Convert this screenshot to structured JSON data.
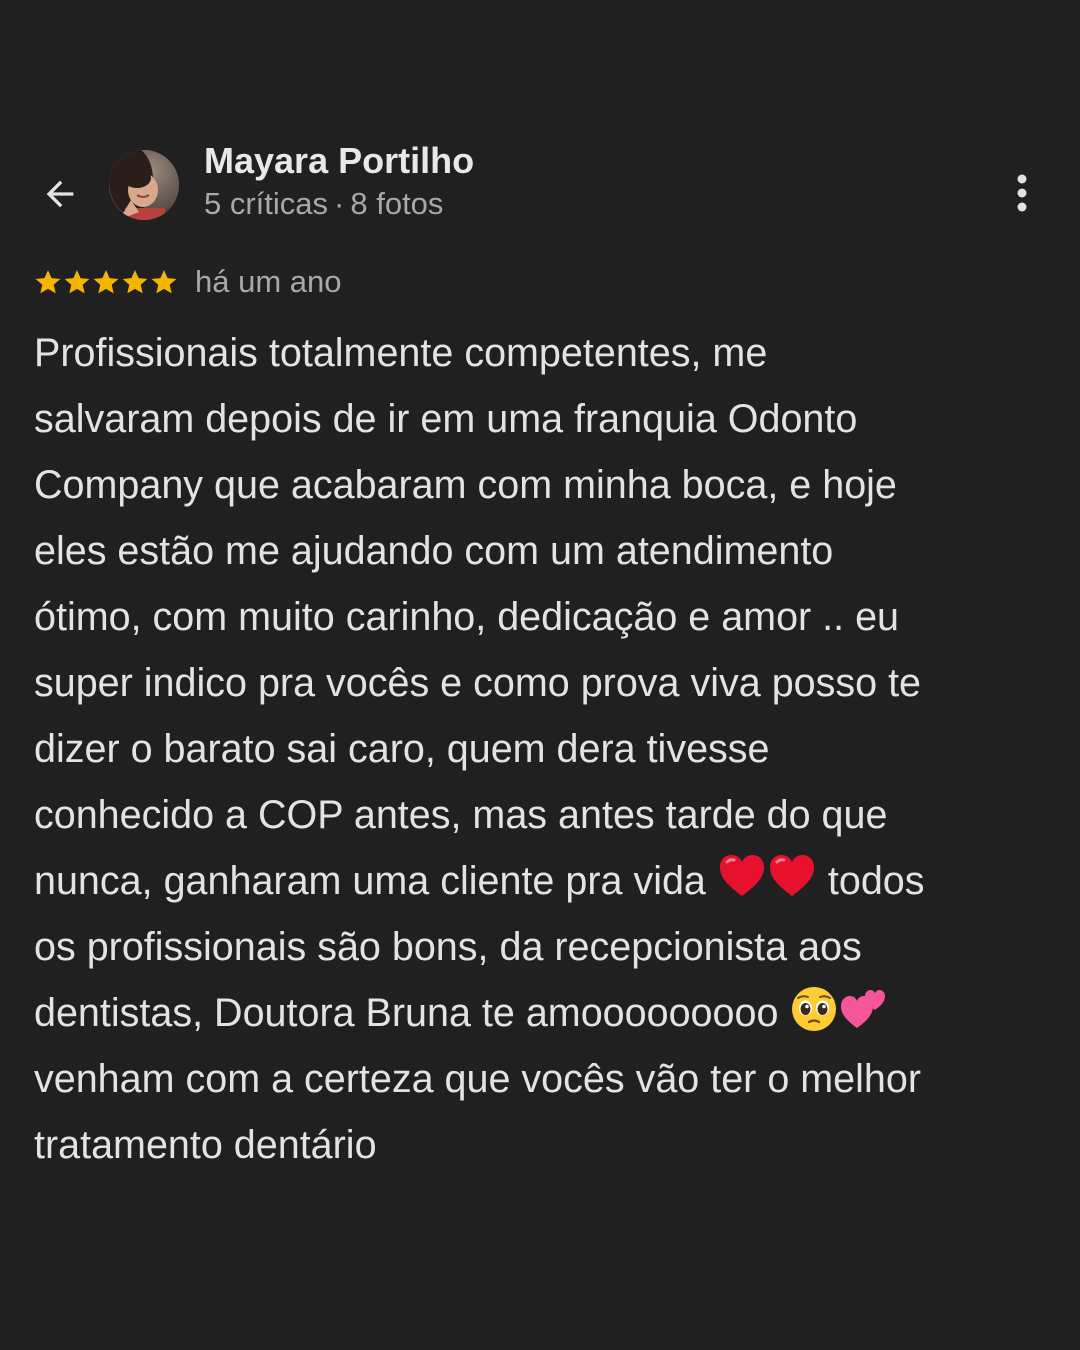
{
  "header": {
    "back_icon": "arrow-back-icon",
    "reviewer_name": "Mayara Portilho",
    "reviews_count": "5 críticas",
    "separator": "·",
    "photos_count": "8 fotos",
    "more_icon": "more-vertical-icon"
  },
  "rating": {
    "stars": 5,
    "max_stars": 5,
    "star_color": "#f5b400",
    "time_ago": "há um ano"
  },
  "review": {
    "lines": [
      "Profissionais totalmente competentes, me",
      "salvaram depois de ir em uma franquia Odonto",
      "Company que acabaram com minha boca, e hoje",
      "eles estão me ajudando com um atendimento",
      "ótimo, com muito carinho, dedicação e amor .. eu",
      "super indico pra vocês e como prova viva posso te",
      "dizer o barato sai caro, quem dera tivesse",
      "conhecido a COP antes, mas antes tarde do que",
      "nunca, ganharam uma cliente pra vida",
      "todos",
      "os profissionais são bons, da recepcionista aos",
      "dentistas, Doutora Bruna te amooooooooo",
      "venham com a certeza que vocês vão ter o melhor",
      "tratamento dentário"
    ],
    "emojis": [
      "red-heart-icon",
      "red-heart-icon",
      "pleading-face-icon",
      "two-hearts-icon"
    ]
  },
  "colors": {
    "background": "#202020",
    "text_primary": "#e3e3e3",
    "text_secondary": "#a8a8a8"
  }
}
